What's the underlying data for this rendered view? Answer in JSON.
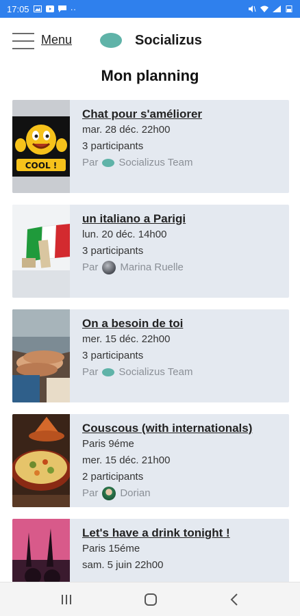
{
  "status_bar": {
    "time": "17:05",
    "dots": "··"
  },
  "header": {
    "menu_label": "Menu",
    "brand": "Socializus",
    "page_title": "Mon planning"
  },
  "events": [
    {
      "title": "Chat pour s'améliorer",
      "lines": [
        "mar. 28 déc. 22h00",
        "3 participants"
      ],
      "by_prefix": "Par",
      "organizer": "Socializus Team",
      "organizer_icon": "socializus-logo-icon",
      "thumb": "cool-smiley"
    },
    {
      "title": "un italiano a Parigi",
      "lines": [
        "lun. 20 déc. 14h00",
        "3 participants"
      ],
      "by_prefix": "Par",
      "organizer": "Marina Ruelle",
      "organizer_icon": "avatar",
      "thumb": "italy-flag"
    },
    {
      "title": "On a besoin de toi",
      "lines": [
        "mer. 15 déc. 22h00",
        "3 participants"
      ],
      "by_prefix": "Par",
      "organizer": "Socializus Team",
      "organizer_icon": "socializus-logo-icon",
      "thumb": "stacked-hands"
    },
    {
      "title": "Couscous (with internationals)",
      "lines": [
        "Paris 9éme",
        "mer. 15 déc. 21h00",
        "2 participants"
      ],
      "by_prefix": "Par",
      "organizer": "Dorian",
      "organizer_icon": "avatar",
      "thumb": "couscous-dish"
    },
    {
      "title": "Let's have a drink tonight !",
      "lines": [
        "Paris 15éme",
        "sam. 5 juin 22h00"
      ],
      "by_prefix": "",
      "organizer": "",
      "organizer_icon": "",
      "thumb": "party-crowd"
    }
  ],
  "colors": {
    "status_bar": "#2f80ed",
    "card_bg": "#e4e9f0",
    "brand_green": "#5fb3a8",
    "muted_text": "#8a8f96"
  },
  "nav": {
    "icons": [
      "recent-apps-icon",
      "home-icon",
      "back-icon"
    ]
  }
}
